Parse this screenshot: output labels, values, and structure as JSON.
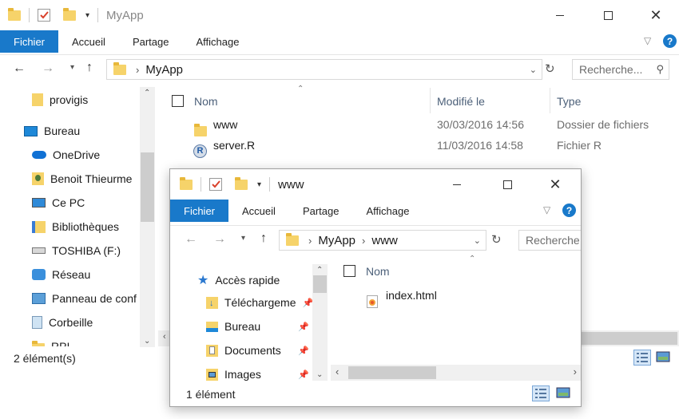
{
  "back_window": {
    "title": "MyApp",
    "ribbon_tabs": [
      "Fichier",
      "Accueil",
      "Partage",
      "Affichage"
    ],
    "address": {
      "crumbs": [
        "MyApp"
      ]
    },
    "search_placeholder": "Recherche...",
    "nav_items": [
      {
        "label": "provigis",
        "icon": "folder-pin-icon"
      },
      {
        "label": "Bureau",
        "icon": "desktop-icon"
      },
      {
        "label": "OneDrive",
        "icon": "onedrive-icon"
      },
      {
        "label": "Benoit Thieurme",
        "icon": "user-folder-icon"
      },
      {
        "label": "Ce PC",
        "icon": "computer-icon"
      },
      {
        "label": "Bibliothèques",
        "icon": "libraries-icon"
      },
      {
        "label": "TOSHIBA (F:)",
        "icon": "drive-icon"
      },
      {
        "label": "Réseau",
        "icon": "network-icon"
      },
      {
        "label": "Panneau de conf",
        "icon": "control-panel-icon"
      },
      {
        "label": "Corbeille",
        "icon": "recycle-bin-icon"
      },
      {
        "label": "RPI",
        "icon": "folder-icon"
      }
    ],
    "columns": {
      "name": "Nom",
      "modified": "Modifié le",
      "type": "Type"
    },
    "files": [
      {
        "name": "www",
        "modified": "30/03/2016 14:56",
        "type": "Dossier de fichiers",
        "icon": "folder-icon"
      },
      {
        "name": "server.R",
        "modified": "11/03/2016 14:58",
        "type": "Fichier R",
        "icon": "r-file-icon"
      }
    ],
    "status": "2 élément(s)"
  },
  "front_window": {
    "title": "www",
    "ribbon_tabs": [
      "Fichier",
      "Accueil",
      "Partage",
      "Affichage"
    ],
    "address": {
      "crumbs": [
        "MyApp",
        "www"
      ]
    },
    "search_placeholder": "Recherche",
    "nav_header": "Accès rapide",
    "nav_items": [
      {
        "label": "Téléchargeme",
        "icon": "downloads-icon"
      },
      {
        "label": "Bureau",
        "icon": "desktop-icon"
      },
      {
        "label": "Documents",
        "icon": "documents-icon"
      },
      {
        "label": "Images",
        "icon": "images-icon"
      }
    ],
    "columns": {
      "name": "Nom"
    },
    "files": [
      {
        "name": "index.html",
        "icon": "html-file-icon"
      }
    ],
    "status": "1 élément"
  },
  "colors": {
    "accent": "#1979ca",
    "folder": "#f6d36a",
    "header_text": "#4c6079"
  }
}
